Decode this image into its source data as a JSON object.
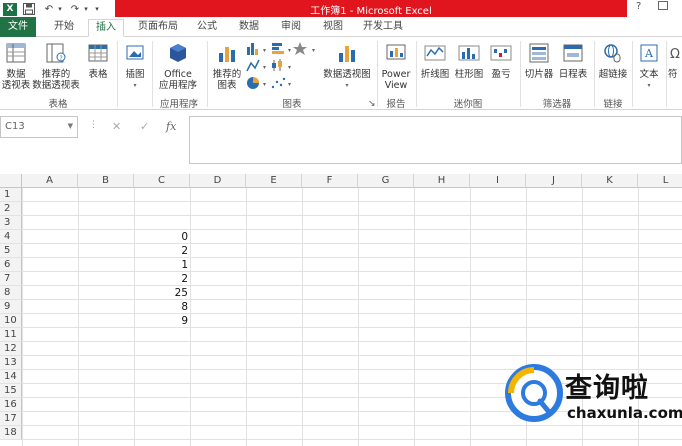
{
  "window": {
    "title": "工作簿1 - Microsoft Excel",
    "help": "?",
    "accent": "#217346",
    "title_bar_color": "#e0151e"
  },
  "qat": {
    "app_icon": "X",
    "save_icon": "💾",
    "undo": "↶",
    "redo": "↷",
    "more": "▾"
  },
  "tabs": [
    {
      "label": "文件"
    },
    {
      "label": "开始"
    },
    {
      "label": "插入"
    },
    {
      "label": "页面布局"
    },
    {
      "label": "公式"
    },
    {
      "label": "数据"
    },
    {
      "label": "审阅"
    },
    {
      "label": "视图"
    },
    {
      "label": "开发工具"
    }
  ],
  "ribbon": {
    "groups": {
      "tables": "表格",
      "apps": "应用程序",
      "charts": "图表",
      "reports": "报告",
      "sparklines": "迷你图",
      "filters": "筛选器",
      "links": "链接"
    },
    "buttons": {
      "pivot_table": "数据\n透视表",
      "recommended_pivot": "推荐的\n数据透视表",
      "table": "表格",
      "illustrations": "插图",
      "office_apps": "Office\n应用程序",
      "recommended_charts": "推荐的\n图表",
      "pivot_chart": "数据透视图",
      "power_view": "Power\nView",
      "line_spark": "折线图",
      "column_spark": "柱形图",
      "winloss_spark": "盈亏",
      "slicer": "切片器",
      "timeline": "日程表",
      "hyperlink": "超链接",
      "text": "文本",
      "symbol": "符"
    }
  },
  "formula_bar": {
    "name_box": "C13",
    "cancel": "✕",
    "enter": "✓",
    "fx": "fx",
    "value": ""
  },
  "grid": {
    "columns": [
      "A",
      "B",
      "C",
      "D",
      "E",
      "F",
      "G",
      "H",
      "I",
      "J",
      "K",
      "L"
    ],
    "rows": [
      "1",
      "2",
      "3",
      "4",
      "5",
      "6",
      "7",
      "8",
      "9",
      "10",
      "11",
      "12",
      "13",
      "14",
      "15",
      "16",
      "17",
      "18"
    ],
    "cells": {
      "C4": "0",
      "C5": "2",
      "C6": "1",
      "C7": "2",
      "C8": "25",
      "C9": "8",
      "C10": "9"
    }
  },
  "watermark": {
    "brand": "查询啦",
    "url": "chaxunla.com"
  }
}
